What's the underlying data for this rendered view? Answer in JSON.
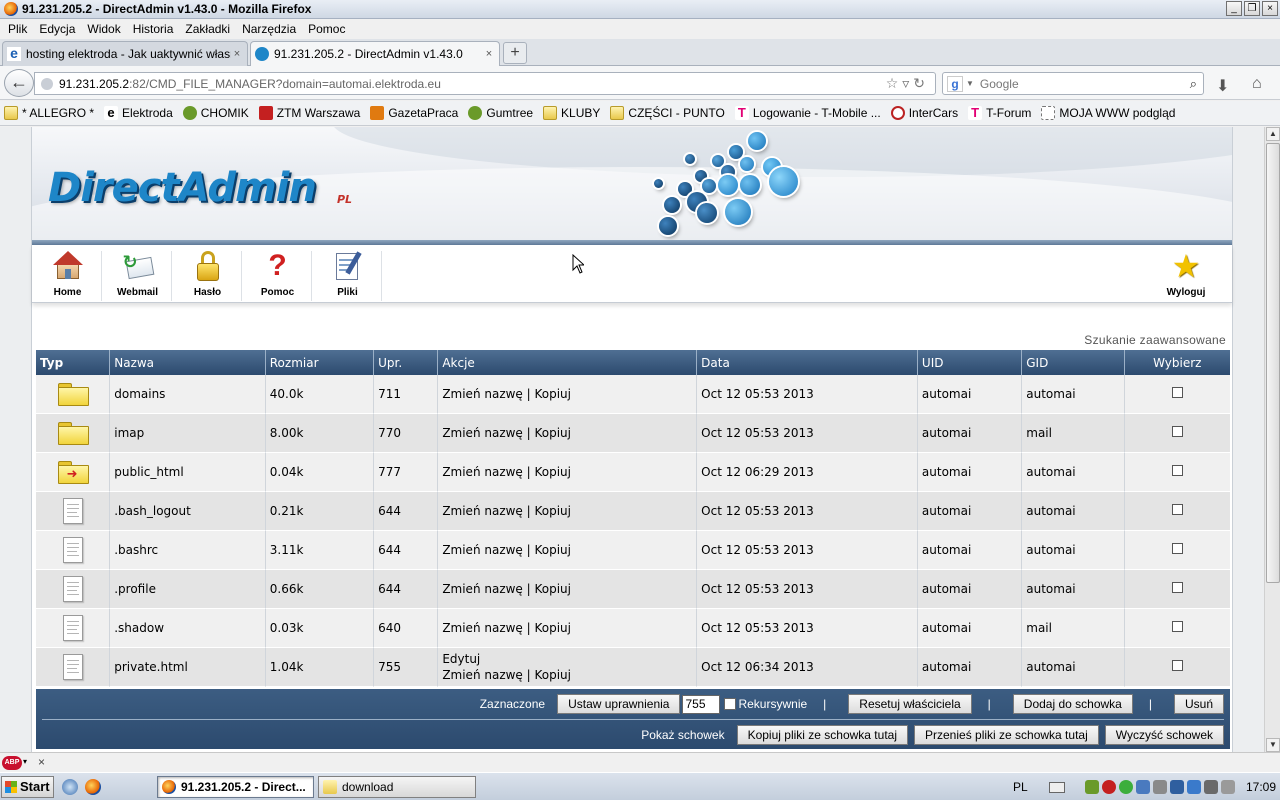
{
  "window": {
    "title": "91.231.205.2 - DirectAdmin v1.43.0 - Mozilla Firefox",
    "controls": [
      "_",
      "❐",
      "×"
    ]
  },
  "menu": [
    "Plik",
    "Edycja",
    "Widok",
    "Historia",
    "Zakładki",
    "Narzędzia",
    "Pomoc"
  ],
  "tabs": [
    {
      "label": "hosting elektroda - Jak uaktywnić własną...",
      "close": "×"
    },
    {
      "label": "91.231.205.2 - DirectAdmin v1.43.0",
      "close": "×"
    }
  ],
  "new_tab": "+",
  "nav": {
    "url_host": "91.231.205.2",
    "url_rest": ":82/CMD_FILE_MANAGER?domain=automai.elektroda.eu",
    "search_placeholder": "Google"
  },
  "bookmarks": [
    {
      "label": "* ALLEGRO *",
      "icon": "folder"
    },
    {
      "label": "Elektroda",
      "icon": "e"
    },
    {
      "label": "CHOMIK",
      "icon": "green"
    },
    {
      "label": "ZTM Warszawa",
      "icon": "red"
    },
    {
      "label": "GazetaPraca",
      "icon": "orange"
    },
    {
      "label": "Gumtree",
      "icon": "green"
    },
    {
      "label": "KLUBY",
      "icon": "folder"
    },
    {
      "label": "CZĘŚCI - PUNTO",
      "icon": "folder"
    },
    {
      "label": "Logowanie - T-Mobile ...",
      "icon": "mag"
    },
    {
      "label": "InterCars",
      "icon": "ring"
    },
    {
      "label": "T-Forum",
      "icon": "mag"
    },
    {
      "label": "MOJA WWW podgląd",
      "icon": "dash"
    }
  ],
  "header": {
    "logo": "DirectAdmin",
    "logo_suffix": "PL"
  },
  "toolbar": {
    "items": [
      "Home",
      "Webmail",
      "Hasło",
      "Pomoc",
      "Pliki"
    ],
    "logout": "Wyloguj"
  },
  "advanced_search": "Szukanie zaawansowane",
  "table": {
    "headers": [
      "Typ",
      "Nazwa",
      "Rozmiar",
      "Upr.",
      "Akcje",
      "Data",
      "UID",
      "GID",
      "Wybierz"
    ],
    "rows": [
      {
        "type": "folder",
        "name": "domains",
        "size": "40.0k",
        "perm": "711",
        "actions": "Zmień nazwę | Kopiuj",
        "edit": "",
        "date": "Oct 12 05:53 2013",
        "uid": "automai",
        "gid": "automai"
      },
      {
        "type": "folder",
        "name": "imap",
        "size": "8.00k",
        "perm": "770",
        "actions": "Zmień nazwę | Kopiuj",
        "edit": "",
        "date": "Oct 12 05:53 2013",
        "uid": "automai",
        "gid": "mail"
      },
      {
        "type": "folder-link",
        "name": "public_html",
        "size": "0.04k",
        "perm": "777",
        "actions": "Zmień nazwę | Kopiuj",
        "edit": "",
        "date": "Oct 12 06:29 2013",
        "uid": "automai",
        "gid": "automai"
      },
      {
        "type": "file",
        "name": ".bash_logout",
        "size": "0.21k",
        "perm": "644",
        "actions": "Zmień nazwę | Kopiuj",
        "edit": "",
        "date": "Oct 12 05:53 2013",
        "uid": "automai",
        "gid": "automai"
      },
      {
        "type": "file",
        "name": ".bashrc",
        "size": "3.11k",
        "perm": "644",
        "actions": "Zmień nazwę | Kopiuj",
        "edit": "",
        "date": "Oct 12 05:53 2013",
        "uid": "automai",
        "gid": "automai"
      },
      {
        "type": "file",
        "name": ".profile",
        "size": "0.66k",
        "perm": "644",
        "actions": "Zmień nazwę | Kopiuj",
        "edit": "",
        "date": "Oct 12 05:53 2013",
        "uid": "automai",
        "gid": "automai"
      },
      {
        "type": "file",
        "name": ".shadow",
        "size": "0.03k",
        "perm": "640",
        "actions": "Zmień nazwę | Kopiuj",
        "edit": "",
        "date": "Oct 12 05:53 2013",
        "uid": "automai",
        "gid": "mail"
      },
      {
        "type": "file",
        "name": "private.html",
        "size": "1.04k",
        "perm": "755",
        "actions": "Zmień nazwę | Kopiuj",
        "edit": "Edytuj",
        "date": "Oct 12 06:34 2013",
        "uid": "automai",
        "gid": "automai"
      }
    ]
  },
  "bottom": {
    "selected_label": "Zaznaczone",
    "set_perms": "Ustaw uprawnienia",
    "perm_value": "755",
    "recursive": "Rekursywnie",
    "sep": "|",
    "reset_owner": "Resetuj właściciela",
    "add_clipboard": "Dodaj do schowka",
    "delete": "Usuń",
    "show_clipboard": "Pokaż schowek",
    "copy_here": "Kopiuj pliki ze schowka tutaj",
    "move_here": "Przenieś pliki ze schowka tutaj",
    "clear_clipboard": "Wyczyść schowek"
  },
  "addon_bar": {
    "abp": "ABP",
    "close": "×"
  },
  "taskbar": {
    "start": "Start",
    "tasks": [
      "91.231.205.2 - Direct...",
      "download"
    ],
    "lang": "PL",
    "clock": "17:09"
  }
}
